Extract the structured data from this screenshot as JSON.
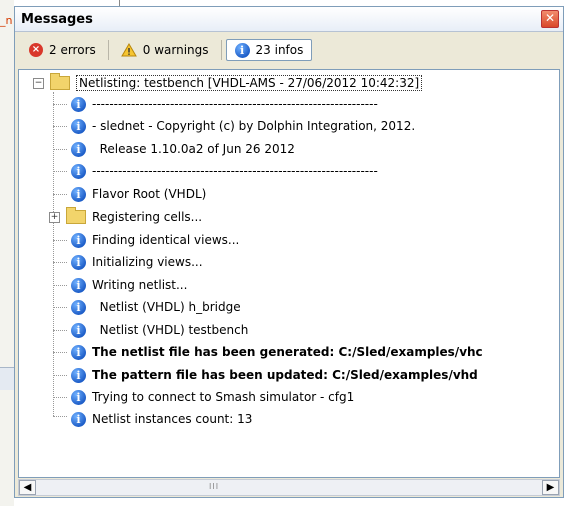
{
  "background": {
    "left_fragment": "_n"
  },
  "panel": {
    "title": "Messages",
    "close_symbol": "✕"
  },
  "toolbar": {
    "errors_label": "2 errors",
    "warnings_label": "0 warnings",
    "infos_label": "23 infos"
  },
  "tree": {
    "root_label": "Netlisting: testbench [VHDL-AMS - 27/06/2012 10:42:32]",
    "messages": [
      "------------------------------------------------------------------",
      "- slednet - Copyright (c) by Dolphin Integration, 2012.",
      "  Release 1.10.0a2 of Jun 26 2012",
      "------------------------------------------------------------------",
      "Flavor Root (VHDL)"
    ],
    "folder_label": "Registering cells...",
    "messages2": [
      "Finding identical views...",
      "Initializing views...",
      "Writing netlist...",
      "  Netlist (VHDL) h_bridge",
      "  Netlist (VHDL) testbench",
      "The netlist file has been generated: C:/Sled/examples/vhc",
      "The pattern file has been updated: C:/Sled/examples/vhd",
      "Trying to connect to Smash simulator - cfg1",
      "Netlist instances count: 13"
    ]
  },
  "colors": {
    "error": "#d9382b",
    "info": "#1f5fc9",
    "folder": "#f2d46b"
  }
}
